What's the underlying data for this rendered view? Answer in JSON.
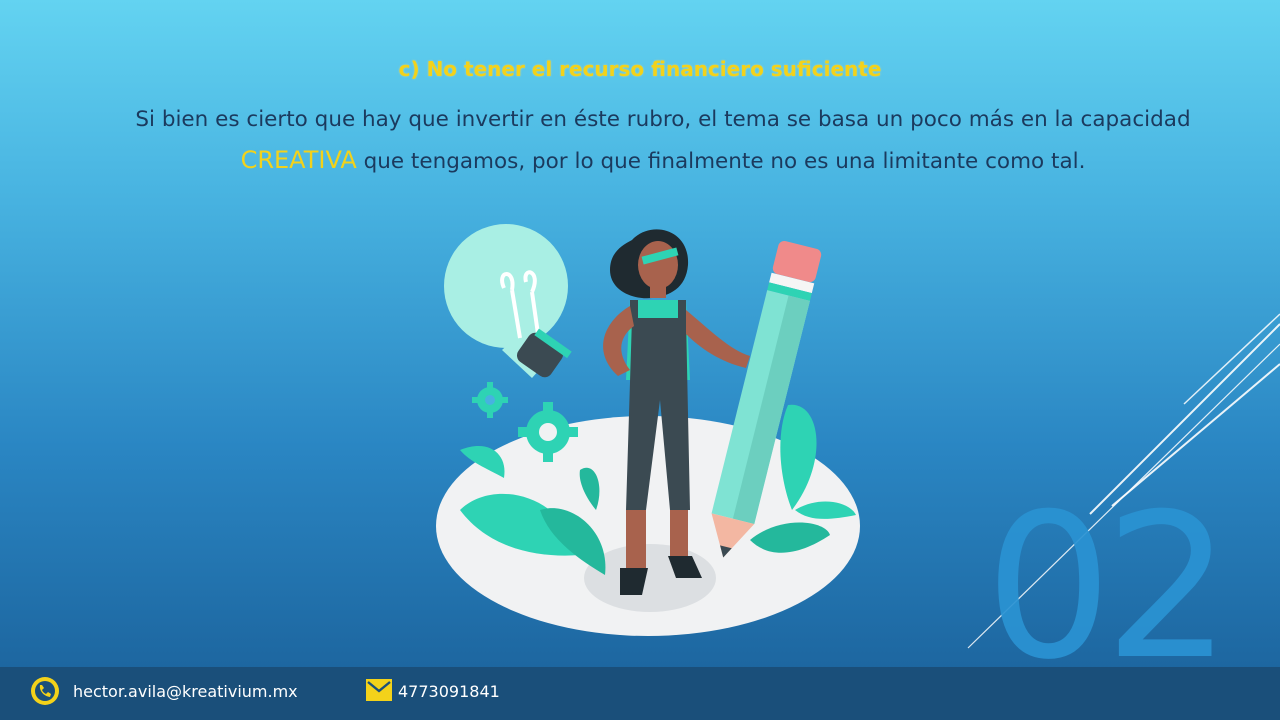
{
  "slide": {
    "heading": "c) No tener el recurso financiero suficiente",
    "paragraph_line1": "Si bien es cierto que hay que invertir en éste rubro, el tema se basa un poco más en la capacidad",
    "paragraph_highlight": "CREATIVA",
    "paragraph_line2_rest": " que tengamos, por lo que finalmente no es una limitante como tal.",
    "slide_number": "02"
  },
  "footer": {
    "email": "hector.avila@kreativium.mx",
    "phone": "4773091841",
    "phone_icon": "phone-icon",
    "mail_icon": "mail-icon"
  },
  "colors": {
    "accent_yellow": "#f3d21a",
    "body_text": "#1b3a5e",
    "footer_bg": "#1a4f7a",
    "number_blue": "#2a93d3",
    "teal": "#2ed3b4"
  }
}
